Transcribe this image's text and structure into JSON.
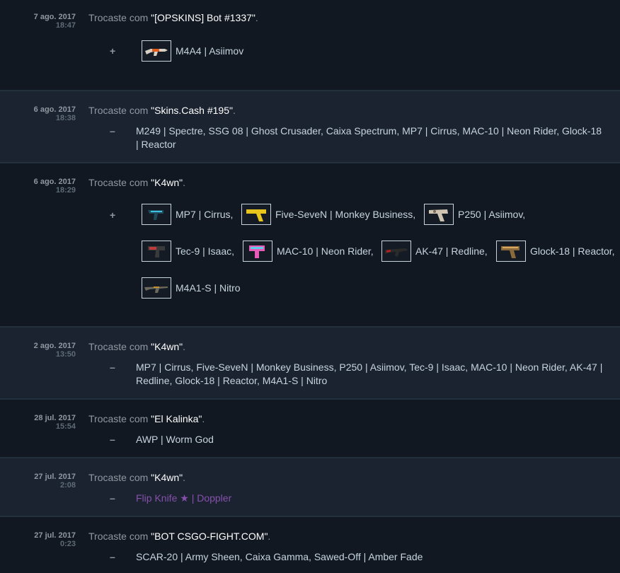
{
  "trades": [
    {
      "date": "7 ago. 2017",
      "time": "18:47",
      "prefix": "Trocaste com ",
      "partner": "\"[OPSKINS] Bot #1337\"",
      "suffix": ".",
      "sign": "+",
      "items": [
        {
          "name": "M4A4 | Asiimov",
          "icon": "rifle-m4a4-asiimov-icon"
        }
      ]
    },
    {
      "date": "6 ago. 2017",
      "time": "18:38",
      "prefix": "Trocaste com ",
      "partner": "\"Skins.Cash #195\"",
      "suffix": ".",
      "sign": "–",
      "items_text": "M249 | Spectre, SSG 08 | Ghost Crusader, Caixa Spectrum, MP7 | Cirrus, MAC-10 | Neon Rider, Glock-18 | Reactor"
    },
    {
      "date": "6 ago. 2017",
      "time": "18:29",
      "prefix": "Trocaste com ",
      "partner": "\"K4wn\"",
      "suffix": ".",
      "sign": "+",
      "items": [
        {
          "name": "MP7 | Cirrus,",
          "icon": "smg-mp7-cirrus-icon"
        },
        {
          "name": "Five-SeveN | Monkey Business,",
          "icon": "pistol-five-seven-icon"
        },
        {
          "name": "P250 | Asiimov,",
          "icon": "pistol-p250-icon"
        },
        {
          "name": "Tec-9 | Isaac,",
          "icon": "pistol-tec9-icon"
        },
        {
          "name": "MAC-10 | Neon Rider,",
          "icon": "smg-mac10-icon"
        },
        {
          "name": "AK-47 | Redline,",
          "icon": "rifle-ak47-icon"
        },
        {
          "name": "Glock-18 | Reactor,",
          "icon": "pistol-glock-icon"
        },
        {
          "name": "M4A1-S | Nitro",
          "icon": "rifle-m4a1s-icon"
        }
      ]
    },
    {
      "date": "2 ago. 2017",
      "time": "13:50",
      "prefix": "Trocaste com ",
      "partner": "\"K4wn\"",
      "suffix": ".",
      "sign": "–",
      "items_text": "MP7 | Cirrus, Five-SeveN | Monkey Business, P250 | Asiimov, Tec-9 | Isaac, MAC-10 | Neon Rider, AK-47 | Redline, Glock-18 | Reactor, M4A1-S | Nitro"
    },
    {
      "date": "28 jul. 2017",
      "time": "15:54",
      "prefix": "Trocaste com ",
      "partner": "\"El Kalinka\"",
      "suffix": ".",
      "sign": "–",
      "items_text": "AWP | Worm God"
    },
    {
      "date": "27 jul. 2017",
      "time": "2:08",
      "prefix": "Trocaste com ",
      "partner": "\"K4wn\"",
      "suffix": ".",
      "sign": "–",
      "items_text": "Flip Knife ★ | Doppler",
      "items_color": "#8650ac"
    },
    {
      "date": "27 jul. 2017",
      "time": "0:23",
      "prefix": "Trocaste com ",
      "partner": "\"BOT CSGO-FIGHT.COM\"",
      "suffix": ".",
      "sign": "–",
      "items_text": "SCAR-20 | Army Sheen, Caixa Gamma, Sawed-Off | Amber Fade"
    }
  ]
}
